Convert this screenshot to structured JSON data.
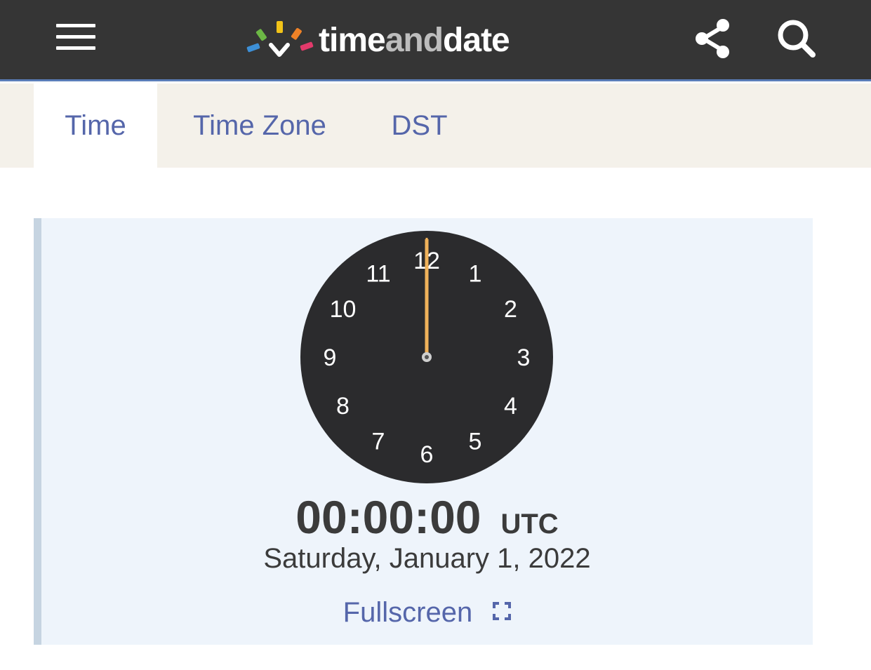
{
  "header": {
    "logo": {
      "text_main": "time",
      "text_dim": "and",
      "text_end": "date"
    },
    "icons": {
      "menu": "hamburger-menu-icon",
      "share": "share-icon",
      "search": "search-icon"
    },
    "colors": {
      "bar": "#353535",
      "accent_line": "#5a7db8"
    }
  },
  "tabs": [
    {
      "label": "Time",
      "active": true
    },
    {
      "label": "Time Zone",
      "active": false
    },
    {
      "label": "DST",
      "active": false
    }
  ],
  "clock": {
    "numerals": [
      "12",
      "1",
      "2",
      "3",
      "4",
      "5",
      "6",
      "7",
      "8",
      "9",
      "10",
      "11"
    ],
    "hands": {
      "hour": 0,
      "minute": 0,
      "second": 0
    },
    "colors": {
      "face": "#2b2b2d",
      "hand": "#f0b25a",
      "numerals": "#ffffff"
    },
    "time": "00:00:00",
    "zone": "UTC",
    "date": "Saturday, January 1, 2022",
    "fullscreen_label": "Fullscreen"
  }
}
